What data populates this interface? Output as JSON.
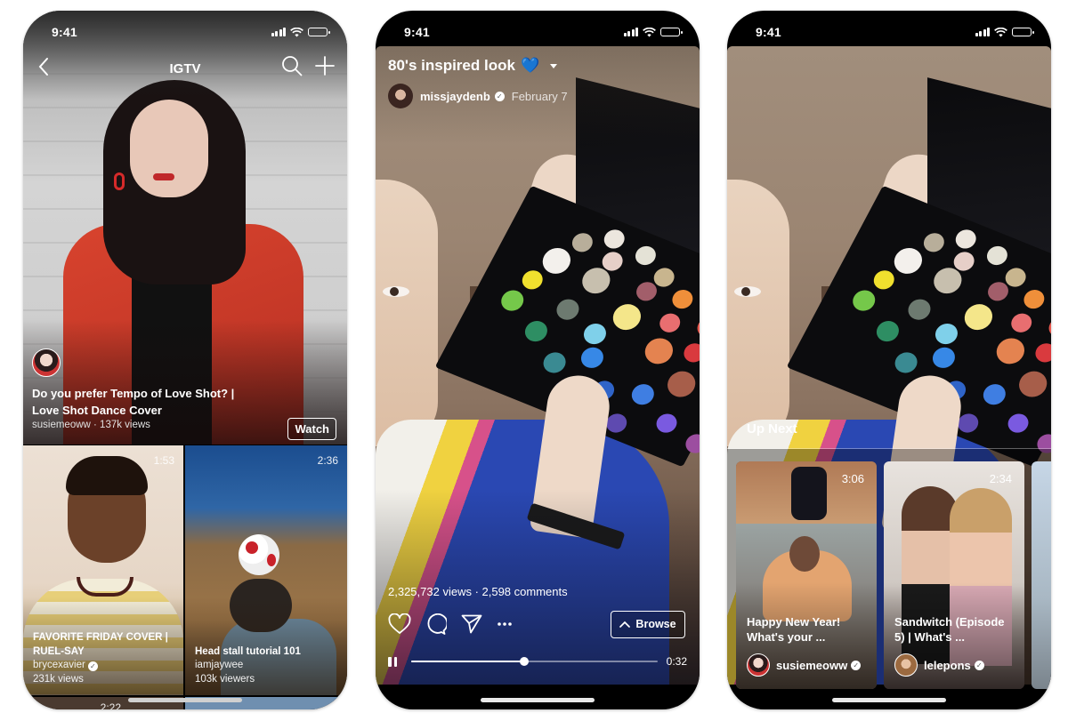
{
  "status_bar": {
    "time": "9:41"
  },
  "phone1": {
    "nav": {
      "title": "IGTV",
      "back_icon": "chevron-left-icon",
      "search_icon": "search-icon",
      "add_icon": "plus-icon"
    },
    "hero": {
      "title": "Do you prefer Tempo of Love Shot? | Love Shot Dance Cover",
      "meta": "susiemeoww · 137k views",
      "watch_label": "Watch"
    },
    "grid": [
      {
        "duration": "1:53",
        "title": "FAVORITE FRIDAY COVER | RUEL-SAY",
        "user": "brycexavier",
        "verified": true,
        "views": "231k views"
      },
      {
        "duration": "2:36",
        "title": "Head stall tutorial 101",
        "user": "iamjaywee",
        "verified": false,
        "views": "103k viewers"
      },
      {
        "duration": "2:22"
      }
    ]
  },
  "phone2": {
    "title": "80's inspired look",
    "emoji": "💙",
    "user": "missjaydenb",
    "verified": true,
    "date": "February 7",
    "stats": "2,325,732 views · 2,598 comments",
    "browse_label": "Browse",
    "time_remaining": "0:32",
    "progress": 0.46
  },
  "phone3": {
    "up_next_label": "Up Next",
    "cards": [
      {
        "duration": "3:06",
        "title": "Happy New Year! What's your ...",
        "user": "susiemeoww",
        "verified": true
      },
      {
        "duration": "2:34",
        "title": "Sandwitch (Episode 5) |  What's ...",
        "user": "lelepons",
        "verified": true
      }
    ]
  },
  "colors": {
    "accent_heart": "#2f7de6",
    "jacket_red": "#d8432e"
  }
}
